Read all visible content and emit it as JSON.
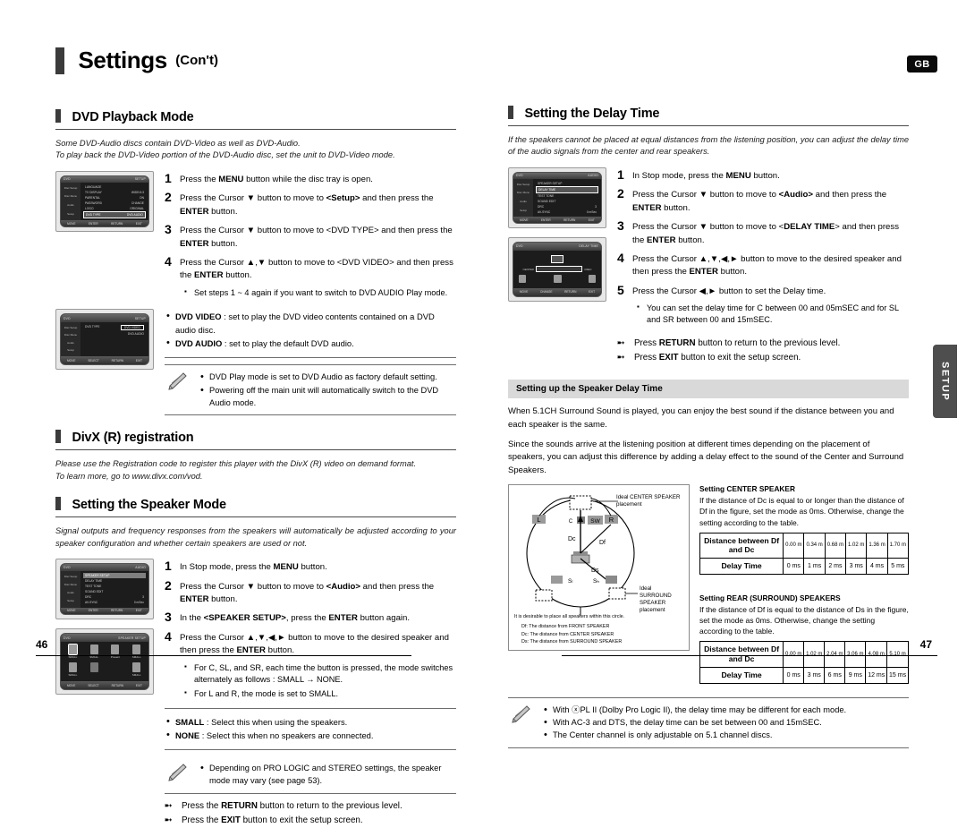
{
  "header": {
    "title": "Settings",
    "cont": "(Con't)",
    "region_badge": "GB",
    "side_tab": "SETUP"
  },
  "footer": {
    "page_left": "46",
    "page_right": "47"
  },
  "left": {
    "dvd_playback": {
      "heading": "DVD Playback Mode",
      "intro": "Some DVD-Audio discs contain DVD-Video as well as DVD-Audio.\nTo play back the DVD-Video portion of the DVD-Audio disc, set the unit to DVD-Video mode.",
      "steps": [
        {
          "num": "1",
          "text": "Press the MENU button while the disc tray is open."
        },
        {
          "num": "2",
          "text": "Press the Cursor ▼ button to move to <Setup> and then press the ENTER button."
        },
        {
          "num": "3",
          "text": "Press the Cursor ▼ button to move to <DVD TYPE> and then press the ENTER button."
        },
        {
          "num": "4",
          "text": "Press the Cursor ▲,▼ button to move to <DVD VIDEO> and then press the ENTER button."
        }
      ],
      "substep": "Set steps 1 ~ 4 again if you want to switch to DVD AUDIO Play mode.",
      "bullets": [
        "DVD VIDEO : set to play the DVD video contents contained on a DVD audio disc.",
        "DVD AUDIO : set to play the default DVD audio."
      ],
      "note": [
        "DVD Play mode is set to DVD Audio as factory default setting.",
        "Powering off the main unit will automatically switch to the DVD Audio mode."
      ],
      "osd1": {
        "title_left": "DVD",
        "title_right": "SETUP",
        "rows": [
          {
            "label": "LANGUAGE",
            "value": ""
          },
          {
            "label": "TV DISPLAY",
            "value": "WIDE/4:3"
          },
          {
            "label": "PARENTAL",
            "value": "ON"
          },
          {
            "label": "PASSWORD",
            "value": "CHANGE"
          },
          {
            "label": "LOGO",
            "value": "ORIGINAL"
          },
          {
            "label": "DVD TYPE",
            "value": "DVD AUDIO"
          }
        ],
        "side": [
          "Disc Setup",
          "Disc Menu",
          "Audio",
          "Setup"
        ],
        "bottom": [
          "MOVE",
          "ENTER",
          "RETURN",
          "EXIT"
        ]
      },
      "osd2": {
        "title_left": "DVD",
        "title_right": "SETUP",
        "rows": [
          {
            "label": "DVD TYPE",
            "value": "DVD VIDEO"
          },
          {
            "label": "",
            "value": "DVD AUDIO"
          }
        ],
        "side": [
          "Disc Setup",
          "Disc Menu",
          "Audio",
          "Setup"
        ],
        "bottom": [
          "MOVE",
          "SELECT",
          "RETURN",
          "EXIT"
        ]
      }
    },
    "divx": {
      "heading": "DivX (R) registration",
      "intro": "Please use the Registration code to register this player with the DivX (R) video on demand format.\nTo learn more, go to www.divx.com/vod."
    },
    "speaker_mode": {
      "heading": "Setting the Speaker Mode",
      "intro": "Signal outputs and frequency responses from the speakers will automatically be adjusted according to your speaker configuration and whether certain speakers are used or not.",
      "steps": [
        {
          "num": "1",
          "text": "In Stop mode, press the MENU button."
        },
        {
          "num": "2",
          "text": "Press the Cursor ▼ button to move to <Audio> and then press the ENTER button."
        },
        {
          "num": "3",
          "text": "In the <SPEAKER SETUP>, press the ENTER button again."
        },
        {
          "num": "4",
          "text": "Press the Cursor ▲,▼,◄,► button to move to the desired speaker and then press the ENTER button."
        }
      ],
      "substeps": [
        "For C, SL, and SR, each time the button is pressed, the mode switches alternately as follows : SMALL → NONE.",
        "For L and R, the mode is set to SMALL."
      ],
      "bullets": [
        "SMALL : Select this when using the speakers.",
        "NONE : Select this when no speakers are connected."
      ],
      "note": [
        "Depending on PRO LOGIC and STEREO settings, the speaker mode may vary (see page 53)."
      ],
      "arrows": [
        "Press the RETURN button to return to the previous level.",
        "Press the EXIT button to exit the setup screen."
      ],
      "osd1": {
        "title_left": "DVD",
        "title_right": "AUDIO",
        "rows": [
          {
            "label": "SPEAKER SETUP",
            "value": ""
          },
          {
            "label": "DELAY TIME",
            "value": ""
          },
          {
            "label": "TEST TONE",
            "value": ""
          },
          {
            "label": "SOUND EDIT",
            "value": ""
          },
          {
            "label": "DRC",
            "value": "3"
          },
          {
            "label": "AV-SYNC",
            "value": "0 mSec"
          }
        ],
        "side": [
          "Disc Setup",
          "Disc Menu",
          "Audio",
          "Setup"
        ],
        "bottom": [
          "MOVE",
          "ENTER",
          "RETURN",
          "EXIT"
        ]
      },
      "osd2": {
        "title_left": "DVD",
        "title_right": "SPEAKER SETUP",
        "speakers": [
          {
            "pos": "L",
            "mode": "SMALL",
            "sel": true
          },
          {
            "pos": "C",
            "mode": "SMALL",
            "sel": false
          },
          {
            "pos": "SW",
            "mode": "Present",
            "sel": false
          },
          {
            "pos": "R",
            "mode": "SMALL",
            "sel": false
          },
          {
            "pos": "SL",
            "mode": "SMALL",
            "sel": false
          },
          {
            "pos": "SUB",
            "mode": "",
            "sel": false
          },
          {
            "pos": "SR",
            "mode": "SMALL",
            "sel": false
          }
        ],
        "bottom": [
          "MOVE",
          "SELECT",
          "RETURN",
          "EXIT"
        ]
      }
    }
  },
  "right": {
    "delay_time": {
      "heading": "Setting the Delay Time",
      "intro": "If the speakers cannot be placed at equal distances from the listening position, you can adjust the delay time of the audio signals from the center and rear speakers.",
      "steps": [
        {
          "num": "1",
          "text": "In Stop mode, press the MENU button."
        },
        {
          "num": "2",
          "text": "Press the Cursor ▼ button to move to <Audio> and then press the ENTER button."
        },
        {
          "num": "3",
          "text": "Press the Cursor ▼ button to move to <DELAY TIME> and then press the ENTER button."
        },
        {
          "num": "4",
          "text": "Press the Cursor ▲,▼,◄,► button to move to the desired speaker and then press the ENTER button."
        },
        {
          "num": "5",
          "text": "Press the Cursor ◄,► button to set the Delay time."
        }
      ],
      "substep": "You can set the delay time for C between 00 and 05mSEC and for SL and SR between 00 and 15mSEC.",
      "arrows": [
        "Press RETURN button to return to the previous level.",
        "Press EXIT button to exit the setup screen."
      ],
      "osd1": {
        "title_left": "DVD",
        "title_right": "AUDIO",
        "rows": [
          {
            "label": "SPEAKER SETUP",
            "value": ""
          },
          {
            "label": "DELAY TIME",
            "value": ""
          },
          {
            "label": "TEST TONE",
            "value": ""
          },
          {
            "label": "SOUND EDIT",
            "value": ""
          },
          {
            "label": "DRC",
            "value": "3"
          },
          {
            "label": "AV-SYNC",
            "value": "0 mSec"
          }
        ],
        "side": [
          "Disc Setup",
          "Disc Menu",
          "Audio",
          "Setup"
        ],
        "bottom": [
          "MOVE",
          "ENTER",
          "RETURN",
          "EXIT"
        ]
      },
      "osd2": {
        "title_left": "DVD",
        "title_right": "DELAY TIME",
        "center_label": "CENTER",
        "unit": "mSEC",
        "bottom": [
          "MOVE",
          "CHANGE",
          "RETURN",
          "EXIT"
        ]
      }
    },
    "speaker_delay": {
      "banner": "Setting up the Speaker Delay Time",
      "paragraphs": [
        "When 5.1CH Surround Sound is played, you can enjoy the best sound if the distance between you and each speaker is the same.",
        "Since the sounds arrive at the listening position at different times depending on the placement of speakers, you can adjust this difference by adding a delay effect to the sound of the Center and Surround Speakers."
      ],
      "figure": {
        "ideal_center_label": "Ideal CENTER SPEAKER placement",
        "ideal_surround_label": "Ideal SURROUND SPEAKER placement",
        "speaker_labels": [
          "L",
          "R",
          "C",
          "SW",
          "SL",
          "SR"
        ],
        "distance_labels": [
          "Dc",
          "Df",
          "Ds"
        ],
        "caption": "It is desirable to place all speakers within this circle.",
        "legend": [
          "Df: The distance from FRONT SPEAKER",
          "Dc: The distance from CENTER SPEAKER",
          "Ds: The distance from SURROUND SPEAKER"
        ]
      },
      "center_table": {
        "title": "Setting CENTER SPEAKER",
        "desc": "If the distance of Dc is equal to or longer than the distance of Df in the figure, set the mode as 0ms. Otherwise, change the setting according to the table.",
        "row1_header": "Distance between Df and Dc",
        "row2_header": "Delay Time",
        "distances": [
          "0.00 m",
          "0.34 m",
          "0.68 m",
          "1.02 m",
          "1.36 m",
          "1.70 m"
        ],
        "delays": [
          "0 ms",
          "1 ms",
          "2 ms",
          "3 ms",
          "4 ms",
          "5 ms"
        ]
      },
      "rear_table": {
        "title": "Setting REAR (SURROUND) SPEAKERS",
        "desc": "If the distance of Df is equal to the distance of Ds in the figure, set the mode as 0ms. Otherwise, change the setting according to the table.",
        "row1_header": "Distance between Df and Dc",
        "row2_header": "Delay Time",
        "distances": [
          "0.00 m",
          "1.02 m",
          "2.04 m",
          "3.06 m",
          "4.08 m",
          "5.10 m"
        ],
        "delays": [
          "0 ms",
          "3 ms",
          "6 ms",
          "9 ms",
          "12 ms",
          "15 ms"
        ]
      },
      "note": [
        "With ⓧPL II (Dolby Pro Logic II), the delay time may be different for each mode.",
        "With AC-3 and DTS, the delay time can be set between 00 and 15mSEC.",
        "The Center channel is only adjustable on 5.1 channel discs."
      ]
    }
  }
}
